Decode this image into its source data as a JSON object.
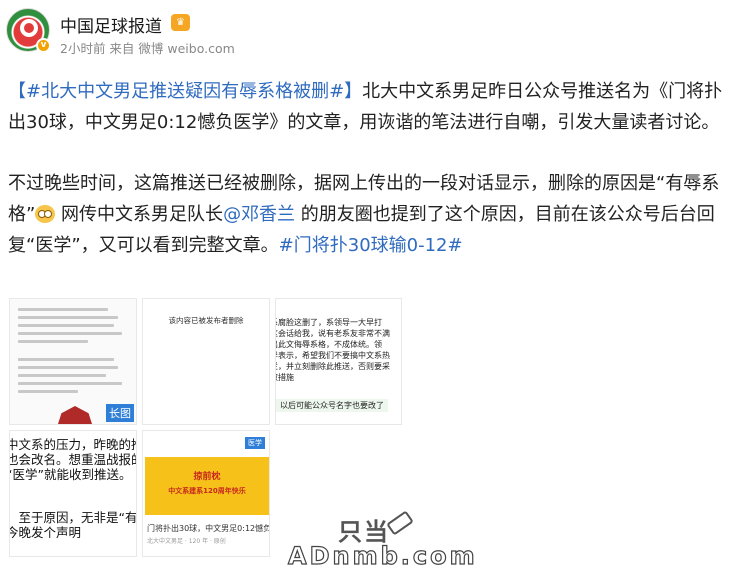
{
  "account": {
    "name": "中国足球报道",
    "meta": "2小时前 来自 微博 weibo.com"
  },
  "post": {
    "p1_tag": "【#北大中文男足推送疑因有辱系格被删#】",
    "p1_text": "北大中文系男足昨日公众号推送名为《门将扑出30球，中文男足0:12憾负医学》的文章，用诙谐的笔法进行自嘲，引发大量读者讨论。",
    "p2_a": "不过晚些时间，这篇推送已经被删除，据网上传出的一段对话显示，删除的原因是“有辱系格”",
    "p2_b": " 网传中文系男足队长",
    "p2_mention": "@邓香兰",
    "p2_c": " 的朋友圈也提到了这个原因，目前在该公众号后台回复“医学”，又可以看到完整文章。",
    "p2_tag": "#门将扑30球输0-12#"
  },
  "images": {
    "t1_badge": "长图",
    "t2_text": "该内容已被发布者删除",
    "t3_lines": [
      "系腐脸这删了，系领导一大早打",
      "这会话给我，说有老系友非常不满",
      "出此文侮辱系格，不成体统。领",
      "导表示，希望我们不要搞中文系热",
      "拦，并立刻删除此推送，否则要采",
      "取措施"
    ],
    "t3_bottom": "以后可能公众号名字也要改了",
    "t4_lines": [
      "中文系的压力，昨晚的推送",
      "也会改名。想重温战报的",
      "“医学”就能收到推送。",
      "",
      "：至于原因，无非是“有辱系",
      "今晚发个声明"
    ],
    "t5_chip": "医学",
    "t5_b1": "掠前枕",
    "t5_b2": "中文系建系120周年快乐",
    "t5_caption": "门将扑出30球，中文男足0:12憾负医学",
    "t5_caption2": "北大中文男足 · 120 年 · 原创"
  },
  "watermark": {
    "top": "只当",
    "bottom": "ADnmb.com"
  }
}
